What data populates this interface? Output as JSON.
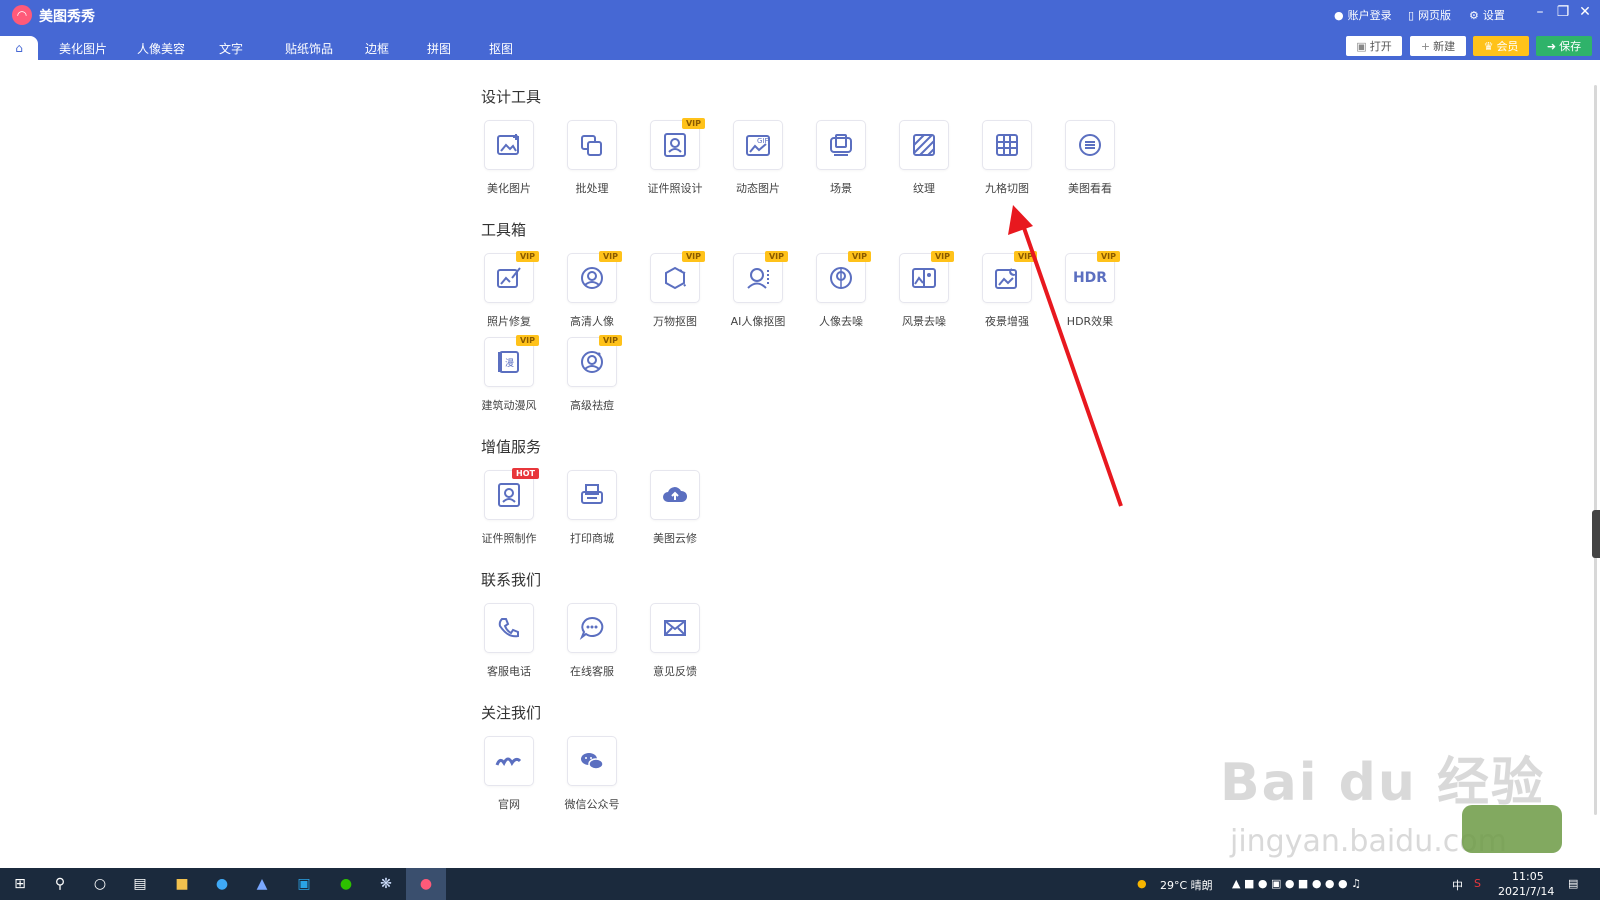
{
  "app": {
    "title": "美图秀秀"
  },
  "topbar": {
    "login": "账户登录",
    "web": "网页版",
    "settings": "设置"
  },
  "tabs": [
    "美化图片",
    "人像美容",
    "文字",
    "贴纸饰品",
    "边框",
    "拼图",
    "抠图"
  ],
  "actions": {
    "open": "打开",
    "new": "新建",
    "vip": "会员",
    "save": "保存"
  },
  "colors": {
    "brand": "#4668d4",
    "vip_badge": "#ffc21a",
    "hot_badge": "#e8363b",
    "icon": "#5b6fc0",
    "arrow": "#e8181f",
    "save_btn": "#2fb36a"
  },
  "sections": {
    "design": {
      "title": "设计工具",
      "items": [
        {
          "label": "美化图片",
          "icon": "image-edit-icon"
        },
        {
          "label": "批处理",
          "icon": "batch-icon"
        },
        {
          "label": "证件照设计",
          "icon": "id-photo-icon",
          "badge": "VIP"
        },
        {
          "label": "动态图片",
          "icon": "gif-icon"
        },
        {
          "label": "场景",
          "icon": "scene-icon"
        },
        {
          "label": "纹理",
          "icon": "texture-icon"
        },
        {
          "label": "九格切图",
          "icon": "grid-icon"
        },
        {
          "label": "美图看看",
          "icon": "viewer-icon"
        }
      ]
    },
    "toolbox": {
      "title": "工具箱",
      "items": [
        {
          "label": "照片修复",
          "icon": "photo-repair-icon",
          "badge": "VIP"
        },
        {
          "label": "高清人像",
          "icon": "hd-portrait-icon",
          "badge": "VIP"
        },
        {
          "label": "万物抠图",
          "icon": "cutout-icon",
          "badge": "VIP"
        },
        {
          "label": "AI人像抠图",
          "icon": "ai-portrait-icon",
          "badge": "VIP"
        },
        {
          "label": "人像去噪",
          "icon": "portrait-denoise-icon",
          "badge": "VIP"
        },
        {
          "label": "风景去噪",
          "icon": "landscape-denoise-icon",
          "badge": "VIP"
        },
        {
          "label": "夜景增强",
          "icon": "night-enhance-icon",
          "badge": "VIP"
        },
        {
          "label": "HDR效果",
          "icon": "hdr-icon",
          "badge": "VIP"
        },
        {
          "label": "建筑动漫风",
          "icon": "anime-building-icon",
          "badge": "VIP"
        },
        {
          "label": "高级祛痘",
          "icon": "acne-removal-icon",
          "badge": "VIP"
        }
      ]
    },
    "services": {
      "title": "增值服务",
      "items": [
        {
          "label": "证件照制作",
          "icon": "id-photo-make-icon",
          "badge": "HOT"
        },
        {
          "label": "打印商城",
          "icon": "print-icon"
        },
        {
          "label": "美图云修",
          "icon": "cloud-edit-icon"
        }
      ]
    },
    "contact": {
      "title": "联系我们",
      "items": [
        {
          "label": "客服电话",
          "icon": "phone-icon"
        },
        {
          "label": "在线客服",
          "icon": "chat-icon"
        },
        {
          "label": "意见反馈",
          "icon": "mail-icon"
        }
      ]
    },
    "follow": {
      "title": "关注我们",
      "items": [
        {
          "label": "官网",
          "icon": "website-icon"
        },
        {
          "label": "微信公众号",
          "icon": "wechat-icon"
        }
      ]
    }
  },
  "hdr_text": "HDR",
  "gif_text": "GIF",
  "manga_text": "漫",
  "taskbar": {
    "weather": "29°C 晴朗",
    "time": "11:05",
    "date": "2021/7/14",
    "ime": "中"
  },
  "watermark": {
    "main": "Bai du 经验",
    "url": "jingyan.baidu.com"
  }
}
